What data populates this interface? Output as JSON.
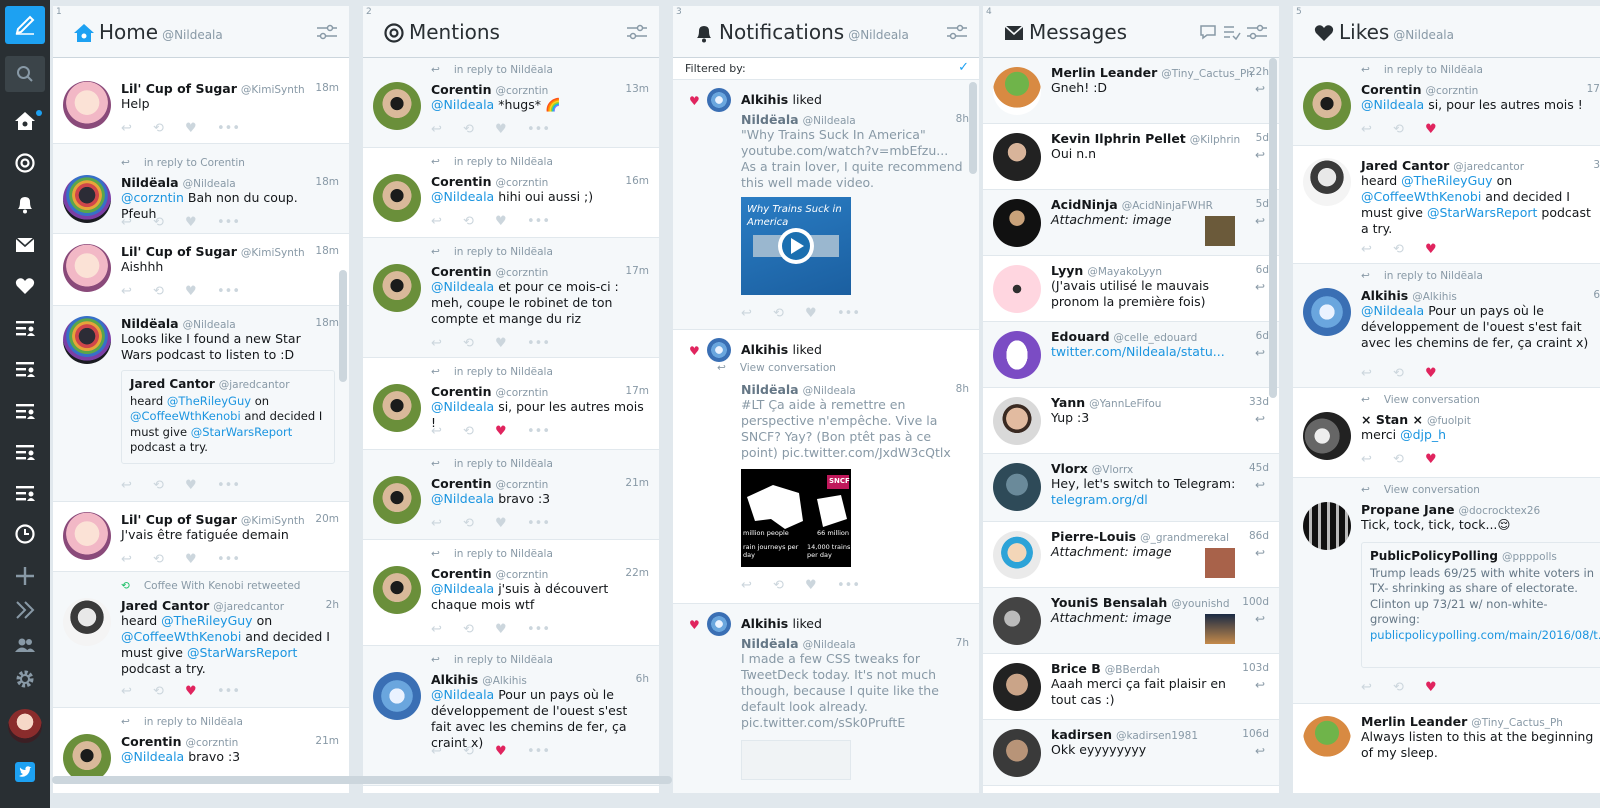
{
  "columns": [
    {
      "num": "1",
      "title": "Home",
      "user": "@Nildeala"
    },
    {
      "num": "2",
      "title": "Mentions",
      "user": ""
    },
    {
      "num": "3",
      "title": "Notifications",
      "user": "@Nildeala"
    },
    {
      "num": "4",
      "title": "Messages",
      "user": ""
    },
    {
      "num": "5",
      "title": "Likes",
      "user": "@Nildeala"
    }
  ],
  "home": [
    {
      "name": "Lil' Cup of Sugar",
      "handle": "@KimiSynth",
      "time": "18m",
      "text": "Help"
    },
    {
      "ctx": "in reply to Corentin",
      "name": "Nildëala",
      "handle": "@Nildeala",
      "time": "18m",
      "link": "@corzntin",
      "text": " Bah non du coup. Pfeuh"
    },
    {
      "name": "Lil' Cup of Sugar",
      "handle": "@KimiSynth",
      "time": "18m",
      "text": "Aishhh"
    },
    {
      "name": "Nildëala",
      "handle": "@Nildeala",
      "time": "18m",
      "text": "Looks like I found a new Star Wars podcast to listen to :D",
      "quote": {
        "name": "Jared Cantor",
        "handle": "@jaredcantor",
        "t1": "heard ",
        "l1": "@TheRileyGuy",
        "t2": " on ",
        "l2": "@CoffeeWthKenobi",
        "t3": " and decided I must give ",
        "l3": "@StarWarsReport",
        "t4": " podcast a try."
      }
    },
    {
      "name": "Lil' Cup of Sugar",
      "handle": "@KimiSynth",
      "time": "20m",
      "text": "J'vais être fatiguée demain"
    },
    {
      "ctx": "Coffee With Kenobi retweeted",
      "name": "Jared Cantor",
      "handle": "@jaredcantor",
      "time": "2h",
      "t1": "heard ",
      "l1": "@TheRileyGuy",
      "t2": " on ",
      "l2": "@CoffeeWthKenobi",
      "t3": " and decided I must give ",
      "l3": "@StarWarsReport",
      "t4": " podcast a try."
    },
    {
      "ctx": "in reply to Nildëala",
      "name": "Corentin",
      "handle": "@corzntin",
      "time": "21m",
      "link": "@Nildeala",
      "text": " bravo :3"
    }
  ],
  "mentions": [
    {
      "ctx": "in reply to Nildëala",
      "name": "Corentin",
      "handle": "@corzntin",
      "time": "13m",
      "link": "@Nildeala",
      "text": " *hugs* 🌈"
    },
    {
      "ctx": "in reply to Nildëala",
      "name": "Corentin",
      "handle": "@corzntin",
      "time": "16m",
      "link": "@Nildeala",
      "text": " hihi oui aussi ;)"
    },
    {
      "ctx": "in reply to Nildëala",
      "name": "Corentin",
      "handle": "@corzntin",
      "time": "17m",
      "link": "@Nildeala",
      "text": " et pour ce mois-ci : meh, coupe le robinet de ton compte et mange du riz"
    },
    {
      "ctx": "in reply to Nildëala",
      "name": "Corentin",
      "handle": "@corzntin",
      "time": "17m",
      "link": "@Nildeala",
      "text": " si, pour les autres mois !"
    },
    {
      "ctx": "in reply to Nildëala",
      "name": "Corentin",
      "handle": "@corzntin",
      "time": "21m",
      "link": "@Nildeala",
      "text": " bravo :3"
    },
    {
      "ctx": "in reply to Nildëala",
      "name": "Corentin",
      "handle": "@corzntin",
      "time": "22m",
      "link": "@Nildeala",
      "text": " j'suis à découvert chaque mois wtf"
    },
    {
      "ctx": "in reply to Nildëala",
      "name": "Alkihis",
      "handle": "@Alkihis",
      "time": "6h",
      "link": "@Nildeala",
      "text": " Pour un pays où le développement de l'ouest s'est fait avec les chemins de fer, ça craint x)"
    }
  ],
  "notifications": {
    "filter": "Filtered by:",
    "items": [
      {
        "actor": "Alkihis",
        "verb": "liked",
        "name": "Nildëala",
        "handle": "@Nildeala",
        "time": "8h",
        "text": "\"Why Trains Suck In America\" youtube.com/watch?v=mbEfzu... As a train lover, I quite recommend this well made video.",
        "media": "Why Trains Suck in America"
      },
      {
        "actor": "Alkihis",
        "verb": "liked",
        "ctx": "View conversation",
        "name": "Nildëala",
        "handle": "@Nildeala",
        "time": "8h",
        "text": "#LT Ça aide à remettre en perspective n'empêche. Vive la SNCF? Yay? (Bon ptêt pas à ce point) pic.twitter.com/JxdW3cQtlx",
        "m1": "SNCF",
        "m2": "million people",
        "m3": "66 million",
        "m4": "rain journeys per day",
        "m5": "14,000 trains per day"
      },
      {
        "actor": "Alkihis",
        "verb": "liked",
        "name": "Nildëala",
        "handle": "@Nildeala",
        "time": "7h",
        "text": "I made a few CSS tweaks for TweetDeck today. It's not much though, because I quite like the default look already. pic.twitter.com/sSk0PruftE"
      }
    ]
  },
  "messages": [
    {
      "name": "Merlin Leander",
      "handle": "@Tiny_Cactus_Ph",
      "time": "22h",
      "text": "Gneh! :D"
    },
    {
      "name": "Kevin Ilphrin Pellet",
      "handle": "@Kilphrin",
      "time": "5d",
      "text": "Oui n.n"
    },
    {
      "name": "AcidNinja",
      "handle": "@AcidNinjaFWHR",
      "time": "5d",
      "text": "Attachment: image"
    },
    {
      "name": "Lyyn",
      "handle": "@MayakoLyyn",
      "time": "6d",
      "text": "(J'avais utilisé le mauvais pronom la première fois)"
    },
    {
      "name": "Edouard",
      "handle": "@celle_edouard",
      "time": "6d",
      "text": "twitter.com/Nildeala/statu..."
    },
    {
      "name": "Yann",
      "handle": "@YannLeFifou",
      "time": "33d",
      "text": "Yup :3"
    },
    {
      "name": "Vlorx",
      "handle": "@Vlorrx",
      "time": "45d",
      "text": "Hey, let's switch to Telegram:",
      "link": "telegram.org/dl"
    },
    {
      "name": "Pierre-Louis",
      "handle": "@_grandmerekal",
      "time": "86d",
      "text": "Attachment: image"
    },
    {
      "name": "YouniS Bensalah",
      "handle": "@younishd",
      "time": "100d",
      "text": "Attachment: image"
    },
    {
      "name": "Brice B",
      "handle": "@BBerdah",
      "time": "103d",
      "text": "Aaah merci ça fait plaisir en tout cas :)"
    },
    {
      "name": "kadirsen",
      "handle": "@kadirsen1981",
      "time": "106d",
      "text": "Okk eyyyyyyyy"
    }
  ],
  "likes": [
    {
      "ctx": "in reply to Nildëala",
      "name": "Corentin",
      "handle": "@corzntin",
      "time": "17",
      "link": "@Nildeala",
      "text": " si, pour les autres mois !"
    },
    {
      "name": "Jared Cantor",
      "handle": "@jaredcantor",
      "time": "3",
      "t1": "heard ",
      "l1": "@TheRileyGuy",
      "t2": " on ",
      "l2": "@CoffeeWthKenobi",
      "t3": " and decided I must give ",
      "l3": "@StarWarsReport",
      "t4": " podcast a try."
    },
    {
      "ctx": "in reply to Nildëala",
      "name": "Alkihis",
      "handle": "@Alkihis",
      "time": "6",
      "link": "@Nildeala",
      "text": " Pour un pays où le développement de l'ouest s'est fait avec les chemins de fer, ça craint x)"
    },
    {
      "ctx": "View conversation",
      "name": "× Stan ×",
      "handle": "@fuolpit",
      "time": "",
      "t1": "merci ",
      "l1": "@djp_h"
    },
    {
      "ctx": "View conversation",
      "name": "Propane Jane",
      "handle": "@docrocktex26",
      "time": "",
      "text": "Tick, tock, tick, tock...😌",
      "quote": {
        "name": "PublicPolicyPolling",
        "handle": "@ppppolls",
        "text": "Trump leads 69/25 with white voters in TX- shrinking as share of electorate. Clinton up 73/21 w/ non-white- growing:",
        "link": "publicpolicypolling.com/main/2016/08/t..."
      }
    },
    {
      "name": "Merlin Leander",
      "handle": "@Tiny_Cactus_Ph",
      "time": "",
      "text": "Always listen to this at the beginning of my sleep."
    }
  ]
}
